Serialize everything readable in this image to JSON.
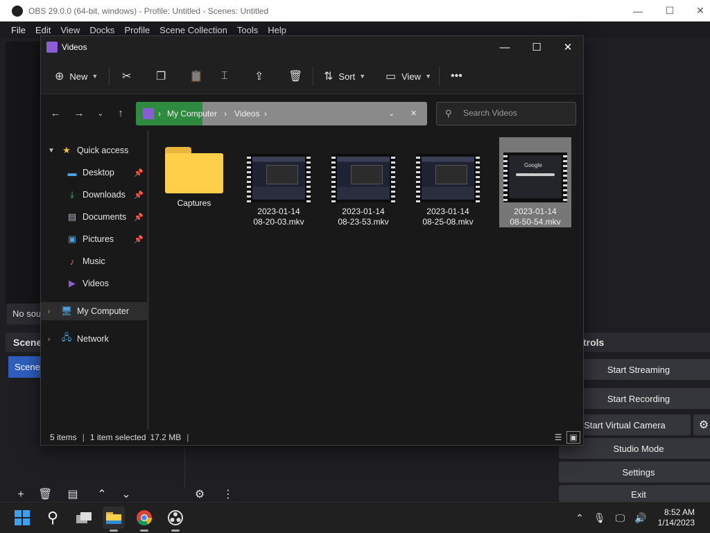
{
  "obs": {
    "title": "OBS 29.0.0 (64-bit, windows) - Profile: Untitled - Scenes: Untitled",
    "menu": [
      "File",
      "Edit",
      "View",
      "Docks",
      "Profile",
      "Scene Collection",
      "Tools",
      "Help"
    ],
    "no_source_text": "No sou",
    "scenes_header": "Scene",
    "scene_item": "Scene",
    "controls_header": "trols",
    "controls": {
      "start_streaming": "Start Streaming",
      "start_recording": "Start Recording",
      "start_virtual_camera": "Start Virtual Camera",
      "studio_mode": "Studio Mode",
      "settings": "Settings",
      "exit": "Exit"
    }
  },
  "explorer": {
    "title": "Videos",
    "toolbar": {
      "new": "New",
      "sort": "Sort",
      "view": "View",
      "more": "•••"
    },
    "address": {
      "root": "My Computer",
      "current": "Videos"
    },
    "search_placeholder": "Search Videos",
    "nav": {
      "quick_access": "Quick access",
      "items": [
        {
          "label": "Desktop",
          "icon": "desktop-icon",
          "pinned": true
        },
        {
          "label": "Downloads",
          "icon": "download-icon",
          "pinned": true
        },
        {
          "label": "Documents",
          "icon": "document-icon",
          "pinned": true
        },
        {
          "label": "Pictures",
          "icon": "pictures-icon",
          "pinned": true
        },
        {
          "label": "Music",
          "icon": "music-icon",
          "pinned": false
        },
        {
          "label": "Videos",
          "icon": "videos-icon",
          "pinned": false
        }
      ],
      "my_computer": "My Computer",
      "network": "Network"
    },
    "files": [
      {
        "name_line1": "Captures",
        "name_line2": "",
        "type": "folder"
      },
      {
        "name_line1": "2023-01-14",
        "name_line2": "08-20-03.mkv",
        "type": "video"
      },
      {
        "name_line1": "2023-01-14",
        "name_line2": "08-23-53.mkv",
        "type": "video"
      },
      {
        "name_line1": "2023-01-14",
        "name_line2": "08-25-08.mkv",
        "type": "video"
      },
      {
        "name_line1": "2023-01-14",
        "name_line2": "08-50-54.mkv",
        "type": "video",
        "selected": true,
        "thumb_text": "Google"
      }
    ],
    "status": {
      "count": "5 items",
      "selected": "1 item selected",
      "size": "17.2 MB"
    }
  },
  "taskbar": {
    "time": "8:52 AM",
    "date": "1/14/2023"
  },
  "colors": {
    "accent_green": "#2d8a3e",
    "scene_blue": "#2e5fc0",
    "folder_yellow": "#ffcf4a",
    "videos_purple": "#8a5cd6"
  }
}
